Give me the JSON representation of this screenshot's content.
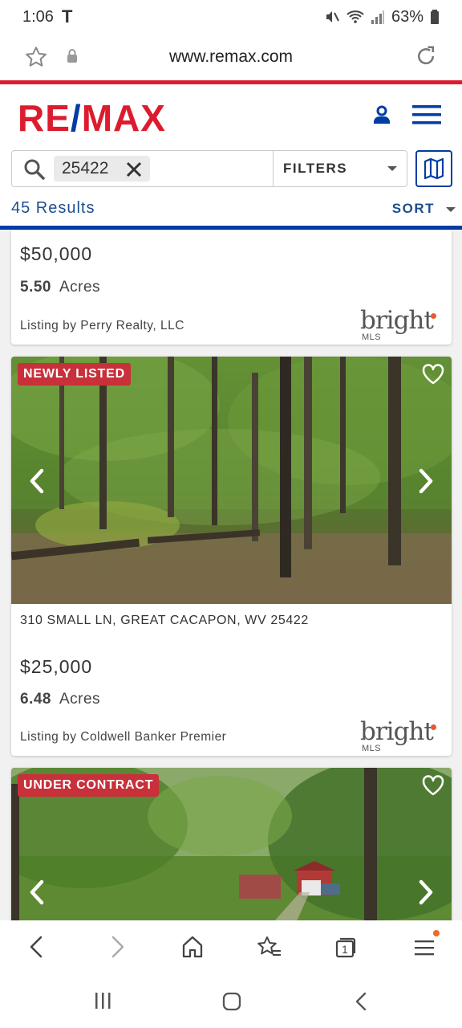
{
  "status_bar": {
    "time": "1:06",
    "carrier": "T",
    "battery": "63%"
  },
  "browser": {
    "url": "www.remax.com"
  },
  "site": {
    "logo_left": "RE",
    "logo_slash": "/",
    "logo_right": "MAX"
  },
  "search": {
    "chip_value": "25422",
    "filters_label": "FILTERS",
    "results_count": "45 Results",
    "sort_label": "SORT"
  },
  "listings": [
    {
      "price": "$50,000",
      "acres_value": "5.50",
      "acres_label": "Acres",
      "broker": "Listing by Perry Realty, LLC",
      "mls_logo": {
        "word": "bright",
        "sub": "MLS"
      }
    },
    {
      "badge": "NEWLY LISTED",
      "address": "310 SMALL LN, GREAT CACAPON, WV 25422",
      "price": "$25,000",
      "acres_value": "6.48",
      "acres_label": "Acres",
      "broker": "Listing by Coldwell Banker Premier",
      "mls_logo": {
        "word": "bright",
        "sub": "MLS"
      }
    },
    {
      "badge": "UNDER CONTRACT"
    }
  ],
  "browser_toolbar": {
    "tabs_count": "1"
  },
  "colors": {
    "remax_red": "#dc1c2e",
    "remax_blue": "#003da5",
    "badge_red": "#c8303a",
    "link_blue": "#1d4e8f"
  }
}
